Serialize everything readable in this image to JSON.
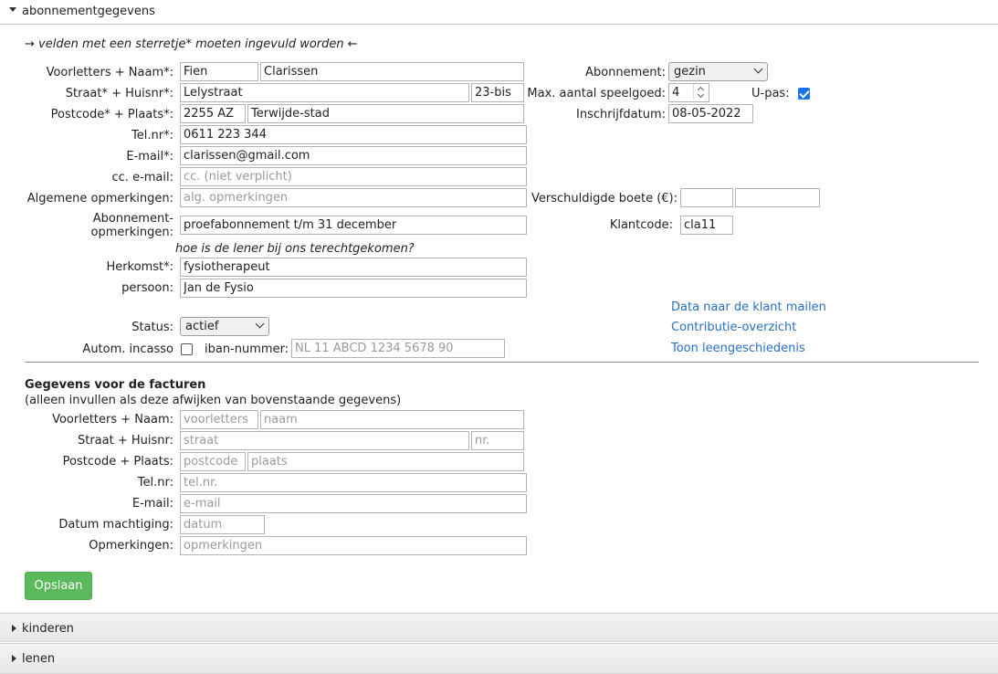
{
  "sections": {
    "main": "abonnementgegevens",
    "kinderen": "kinderen",
    "lenen": "lenen"
  },
  "required_note": "→ velden met een sterretje* moeten ingevuld worden ←",
  "labels": {
    "naam": "Voorletters + Naam*:",
    "straat": "Straat* + Huisnr*:",
    "postcode": "Postcode* + Plaats*:",
    "tel": "Tel.nr*:",
    "email": "E-mail*:",
    "ccemail": "cc. e-mail:",
    "opmerkingen": "Algemene opmerkingen:",
    "abo_opm_1": "Abonnement-",
    "abo_opm_2": "opmerkingen:",
    "herkomst_note": "hoe is de lener bij ons terechtgekomen?",
    "herkomst": "Herkomst*:",
    "persoon": "persoon:",
    "status": "Status:",
    "incasso": "Autom. incasso",
    "iban": "iban-nummer:",
    "abonnement": "Abonnement:",
    "speelgoed": "Max. aantal speelgoed:",
    "upas": "U-pas:",
    "inschrijf": "Inschrijfdatum:",
    "boete": "Verschuldigde boete (€):",
    "klantcode": "Klantcode:"
  },
  "values": {
    "voorletters": "Fien",
    "naam": "Clarissen",
    "straat": "Lelystraat",
    "huisnr": "23-bis",
    "postcode": "2255 AZ",
    "plaats": "Terwijde-stad",
    "tel": "0611 223 344",
    "email": "clarissen@gmail.com",
    "abo_opm": "proefabonnement t/m 31 december",
    "herkomst": "fysiotherapeut",
    "persoon": "Jan de Fysio",
    "status": "actief",
    "abonnement": "gezin",
    "speelgoed": "4",
    "inschrijf": "08-05-2022",
    "klantcode": "cla11"
  },
  "placeholders": {
    "ccemail": "cc. (niet verplicht)",
    "opmerkingen": "alg. opmerkingen",
    "iban": "NL 11 ABCD 1234 5678 90"
  },
  "links": {
    "mail": "Data naar de klant mailen",
    "contributie": "Contributie-overzicht",
    "geschiedenis": "Toon leengeschiedenis"
  },
  "facturen": {
    "title": "Gegevens voor de facturen",
    "subtitle": "(alleen invullen als deze afwijken van bovenstaande gegevens)",
    "labels": {
      "naam": "Voorletters + Naam:",
      "straat": "Straat + Huisnr:",
      "postcode": "Postcode + Plaats:",
      "tel": "Tel.nr:",
      "email": "E-mail:",
      "datum": "Datum machtiging:",
      "opm": "Opmerkingen:"
    },
    "placeholders": {
      "voorletters": "voorletters",
      "naam": "naam",
      "straat": "straat",
      "nr": "nr.",
      "postcode": "postcode",
      "plaats": "plaats",
      "tel": "tel.nr.",
      "email": "e-mail",
      "datum": "datum",
      "opm": "opmerkingen"
    }
  },
  "buttons": {
    "save": "Opslaan"
  },
  "colors": {
    "save": "#5cb85c",
    "link": "#2a6fbf",
    "checkbox": "#1a73e8"
  }
}
